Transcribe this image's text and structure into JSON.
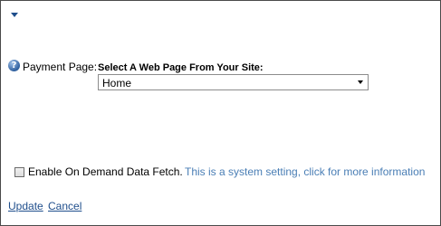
{
  "form": {
    "payment_page_label": "Payment Page:",
    "select_label": "Select A Web Page From Your Site:",
    "selected_page": "Home",
    "on_demand_label": "Enable On Demand Data Fetch.",
    "on_demand_info": "This is a system setting, click for more information",
    "on_demand_checked": false,
    "help_icon": "question-icon",
    "collapse_icon": "caret-down-icon"
  },
  "actions": {
    "update_label": "Update",
    "cancel_label": "Cancel"
  },
  "colors": {
    "link": "#1f4e8c",
    "info_text": "#4a7eb5",
    "border": "#4a4a4a"
  }
}
